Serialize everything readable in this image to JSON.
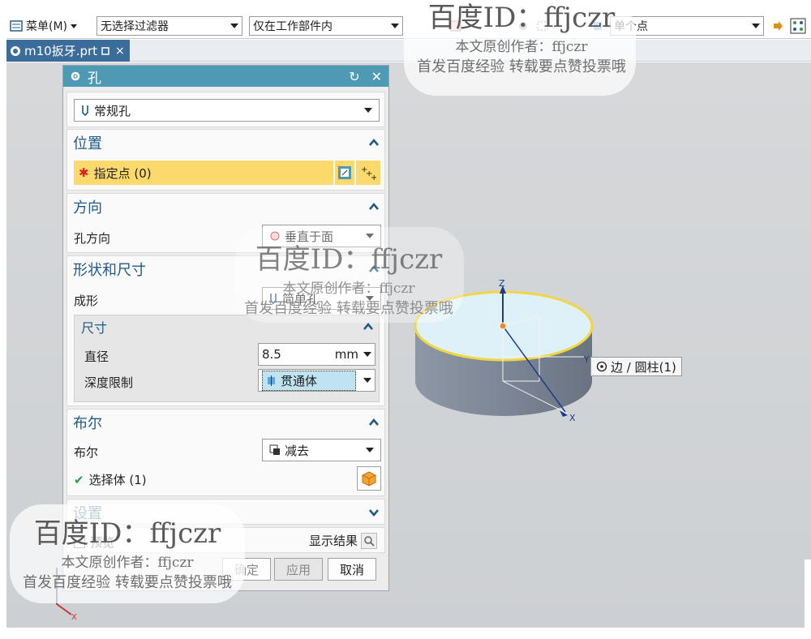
{
  "toolbar": {
    "menu_label": "菜单(M)",
    "filter_value": "无选择过滤器",
    "scope_value": "仅在工作部件内",
    "point_value": "单个点"
  },
  "tab": {
    "label": "m10扳牙.prt"
  },
  "dialog": {
    "title": "孔",
    "type_value": "常规孔",
    "sections": {
      "position": {
        "title": "位置",
        "specify_point": "指定点 (0)"
      },
      "direction": {
        "title": "方向",
        "label": "孔方向",
        "value": "垂直于面"
      },
      "shape": {
        "title": "形状和尺寸",
        "form_label": "成形",
        "form_value": "简单孔",
        "dimensions": {
          "title": "尺寸",
          "diameter_label": "直径",
          "diameter_value": "8.5",
          "diameter_unit": "mm",
          "depth_label": "深度限制",
          "depth_value": "贯通体"
        }
      },
      "boolean": {
        "title": "布尔",
        "label": "布尔",
        "value": "减去",
        "select_body": "选择体 (1)"
      },
      "settings": {
        "title": "设置",
        "preview": "预览",
        "show_result": "显示结果"
      }
    },
    "buttons": {
      "ok": "确定",
      "apply": "应用",
      "cancel": "取消"
    }
  },
  "viewport": {
    "tooltip": "边 / 圆柱(1)",
    "axis_z": "Z",
    "axis_x": "X",
    "axis_y": "Y"
  },
  "watermark": {
    "line1": "百度ID：ffjczr",
    "line2": "本文原创作者：ffjczr",
    "line3": "首发百度经验 转载要点赞投票哦"
  },
  "colors": {
    "title_bar": "#4e9ab5",
    "highlight_row": "#fbd96c",
    "section_title": "#1e5a8a",
    "tab_active": "#3b6d9a",
    "cylinder_top": "#dff1f8",
    "cylinder_side": "#7d8696",
    "edge_highlight": "#f2d640"
  }
}
